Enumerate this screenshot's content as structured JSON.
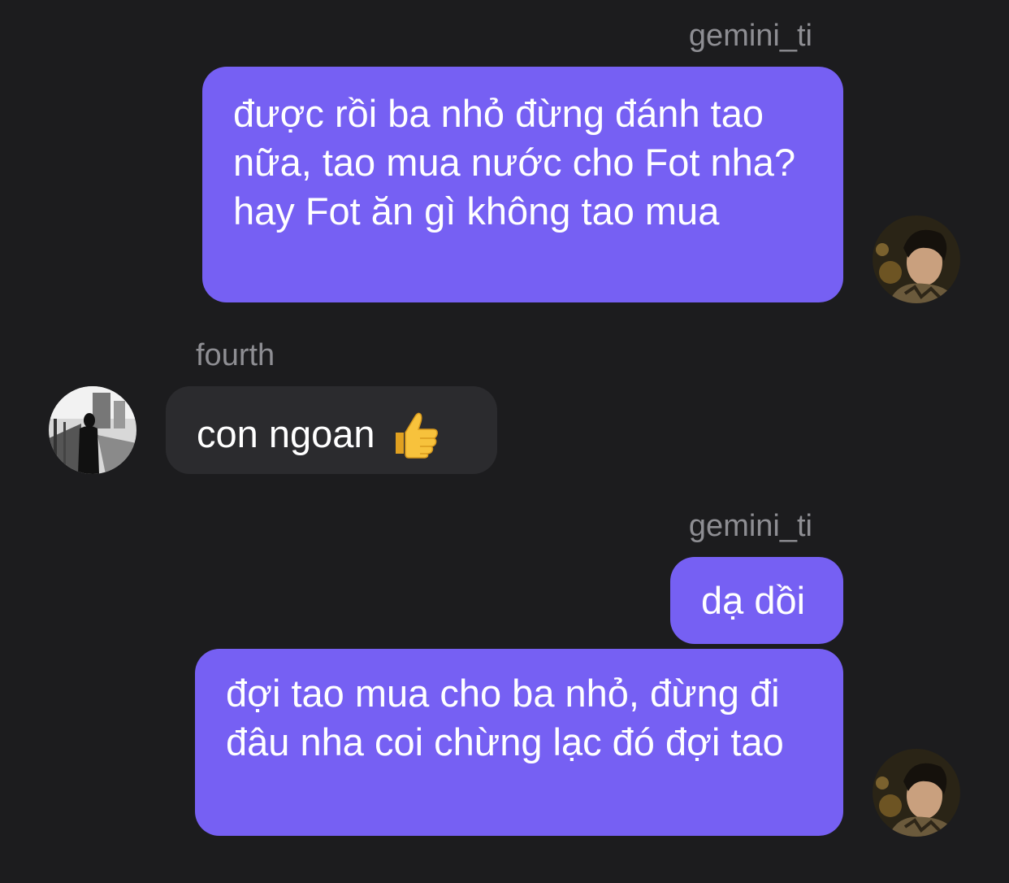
{
  "messages": [
    {
      "sender": "gemini_ti",
      "direction": "outgoing",
      "bubbles": [
        "được rồi ba nhỏ đừng đánh tao nữa, tao mua nước cho Fot nha? hay Fot ăn gì không tao mua"
      ],
      "avatar": "user-avatar-photo"
    },
    {
      "sender": "fourth",
      "direction": "incoming",
      "bubbles": [
        "con ngoan"
      ],
      "emoji": "thumbs-up-icon",
      "avatar": "user-avatar-photo"
    },
    {
      "sender": "gemini_ti",
      "direction": "outgoing",
      "bubbles": [
        "dạ dồi",
        "đợi tao mua cho ba nhỏ, đừng đi đâu nha coi chừng lạc đó đợi tao"
      ],
      "avatar": "user-avatar-photo"
    }
  ],
  "colors": {
    "background": "#1c1c1e",
    "outgoing_bubble": "#7660f3",
    "incoming_bubble": "#2b2b2e",
    "sender_name": "#8e8e93",
    "message_text": "#ffffff"
  }
}
